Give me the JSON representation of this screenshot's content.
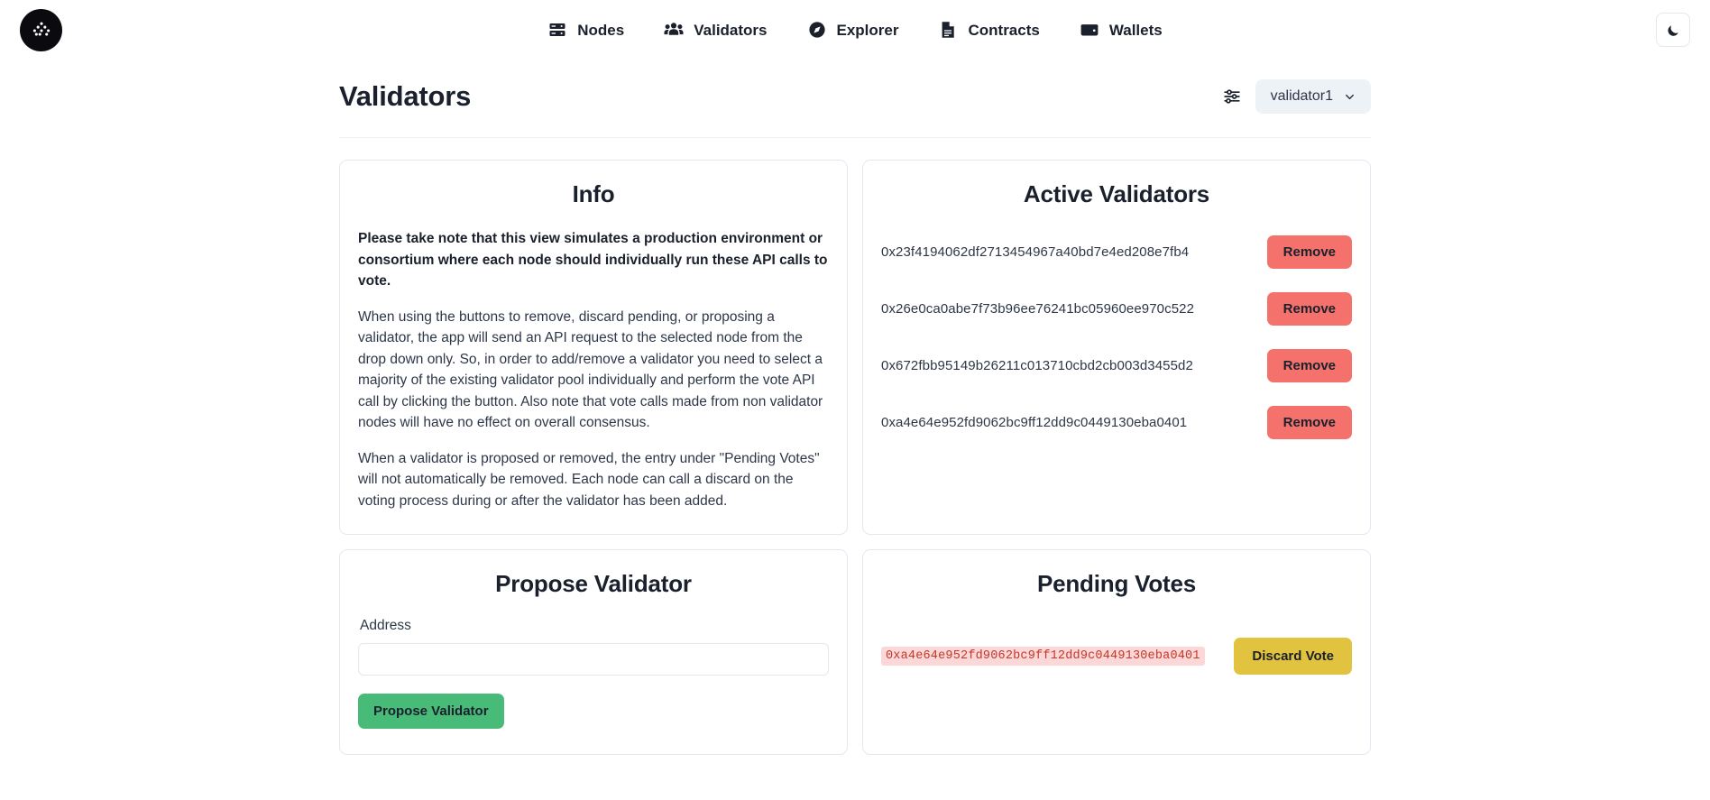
{
  "header": {
    "logo_icon": "dots-pyramid-logo-icon",
    "nav": [
      {
        "label": "Nodes",
        "icon": "server-icon"
      },
      {
        "label": "Validators",
        "icon": "users-group-icon"
      },
      {
        "label": "Explorer",
        "icon": "compass-icon"
      },
      {
        "label": "Contracts",
        "icon": "document-icon"
      },
      {
        "label": "Wallets",
        "icon": "wallet-icon"
      }
    ],
    "theme_toggle_icon": "moon-icon"
  },
  "page": {
    "title": "Validators",
    "settings_icon": "sliders-icon",
    "node_select": {
      "value": "validator1",
      "chevron_icon": "chevron-down-icon"
    }
  },
  "info_card": {
    "title": "Info",
    "paragraphs": [
      "Please take note that this view simulates a production environment or consortium where each node should individually run these API calls to vote.",
      "When using the buttons to remove, discard pending, or proposing a validator, the app will send an API request to the selected node from the drop down only. So, in order to add/remove a validator you need to select a majority of the existing validator pool individually and perform the vote API call by clicking the button. Also note that vote calls made from non validator nodes will have no effect on overall consensus.",
      "When a validator is proposed or removed, the entry under \"Pending Votes\" will not automatically be removed. Each node can call a discard on the voting process during or after the validator has been added."
    ]
  },
  "active_validators": {
    "title": "Active Validators",
    "remove_label": "Remove",
    "rows": [
      {
        "address": "0x23f4194062df2713454967a40bd7e4ed208e7fb4"
      },
      {
        "address": "0x26e0ca0abe7f73b96ee76241bc05960ee970c522"
      },
      {
        "address": "0x672fbb95149b26211c013710cbd2cb003d3455d2"
      },
      {
        "address": "0xa4e64e952fd9062bc9ff12dd9c0449130eba0401"
      }
    ]
  },
  "propose_validator": {
    "title": "Propose Validator",
    "address_label": "Address",
    "address_value": "",
    "address_placeholder": "",
    "submit_label": "Propose Validator"
  },
  "pending_votes": {
    "title": "Pending Votes",
    "discard_label": "Discard Vote",
    "rows": [
      {
        "address": "0xa4e64e952fd9062bc9ff12dd9c0449130eba0401"
      }
    ]
  },
  "colors": {
    "remove_button": "#f4726b",
    "propose_button": "#48bb78",
    "discard_button": "#e2c340",
    "code_background": "#fbd7d7",
    "code_text": "#c0392b",
    "select_background": "#edf2f7",
    "card_border": "#e2e8f0"
  }
}
